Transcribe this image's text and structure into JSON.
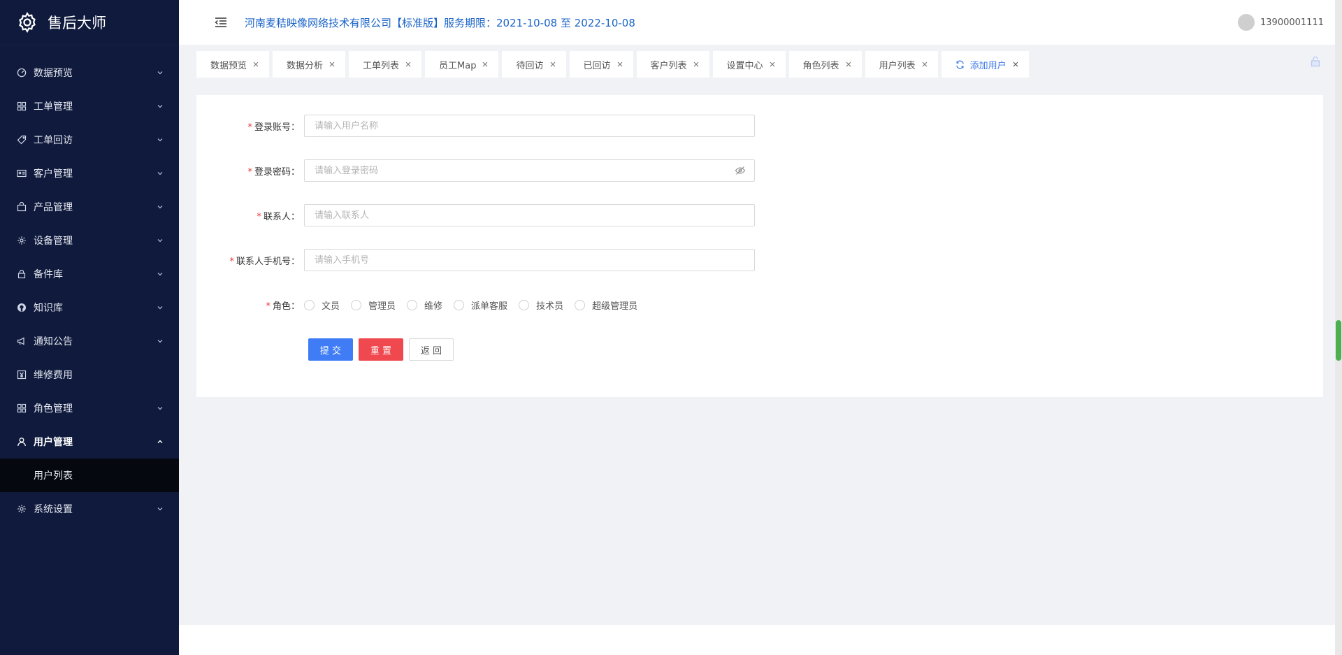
{
  "brand": {
    "title": "售后大师",
    "icon": "gear-logo-icon"
  },
  "sidebar": {
    "items": [
      {
        "label": "数据预览",
        "icon": "dashboard-icon"
      },
      {
        "label": "工单管理",
        "icon": "grid-icon"
      },
      {
        "label": "工单回访",
        "icon": "tag-icon"
      },
      {
        "label": "客户管理",
        "icon": "id-card-icon"
      },
      {
        "label": "产品管理",
        "icon": "bag-icon"
      },
      {
        "label": "设备管理",
        "icon": "gear-icon"
      },
      {
        "label": "备件库",
        "icon": "lock-icon"
      },
      {
        "label": "知识库",
        "icon": "github-icon"
      },
      {
        "label": "通知公告",
        "icon": "megaphone-icon"
      },
      {
        "label": "维修费用",
        "icon": "yen-icon"
      },
      {
        "label": "角色管理",
        "icon": "grid-icon"
      },
      {
        "label": "用户管理",
        "icon": "user-icon"
      },
      {
        "label": "系统设置",
        "icon": "gear-icon"
      }
    ],
    "submenu": {
      "label": "用户列表"
    }
  },
  "header": {
    "company": "河南麦秸映像网络技术有限公司【标准版】服务期限：2021-10-08 至 2022-10-08",
    "user": "13900001111"
  },
  "tabs": [
    {
      "label": "数据预览"
    },
    {
      "label": "数据分析"
    },
    {
      "label": "工单列表"
    },
    {
      "label": "员工Map"
    },
    {
      "label": "待回访"
    },
    {
      "label": "已回访"
    },
    {
      "label": "客户列表"
    },
    {
      "label": "设置中心"
    },
    {
      "label": "角色列表"
    },
    {
      "label": "用户列表"
    },
    {
      "label": "添加用户"
    }
  ],
  "form": {
    "account": {
      "label": "登录账号：",
      "placeholder": "请输入用户名称"
    },
    "password": {
      "label": "登录密码：",
      "placeholder": "请输入登录密码"
    },
    "contact": {
      "label": "联系人：",
      "placeholder": "请输入联系人"
    },
    "phone": {
      "label": "联系人手机号：",
      "placeholder": "请输入手机号"
    },
    "role": {
      "label": "角色：",
      "options": [
        "文员",
        "管理员",
        "维修",
        "派单客服",
        "技术员",
        "超级管理员"
      ]
    },
    "required_mark": "*",
    "buttons": {
      "submit": "提 交",
      "reset": "重 置",
      "back": "返 回"
    }
  },
  "colors": {
    "sidebar_bg": "#0f1a3c",
    "accent": "#3f7cf5",
    "danger": "#f0484f",
    "link": "#1a64c8"
  }
}
